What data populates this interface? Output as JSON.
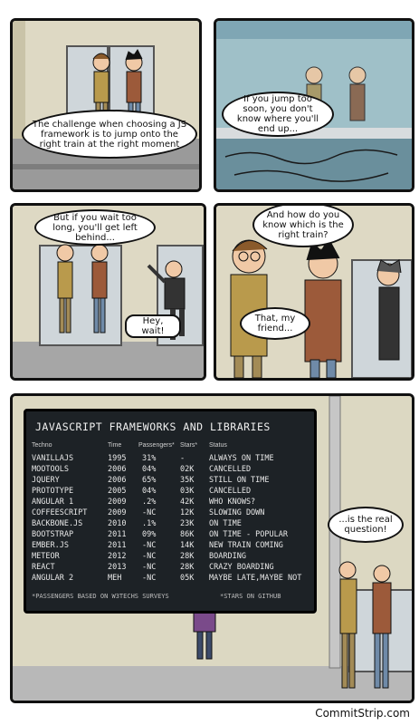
{
  "panel1": {
    "caption": "The challenge when choosing a JS framework is to jump onto the right train at the right moment"
  },
  "panel2": {
    "caption": "If you jump too soon, you don't know where you'll end up..."
  },
  "panel3": {
    "caption1": "But if you wait too long, you'll get left behind...",
    "caption2": "Hey, wait!"
  },
  "panel4": {
    "caption1": "And how do you know which is the right train?",
    "caption2": "That, my friend..."
  },
  "panel5": {
    "board_title": "JAVASCRIPT FRAMEWORKS AND LIBRARIES",
    "headers": {
      "techno": "Techno",
      "time": "Time",
      "passengers": "Passengers*",
      "stars": "Stars*",
      "status": "Status"
    },
    "rows": [
      {
        "techno": "VANILLAJS",
        "time": "1995",
        "passengers": "31%",
        "stars": "-",
        "status": "ALWAYS ON TIME"
      },
      {
        "techno": "MOOTOOLS",
        "time": "2006",
        "passengers": "04%",
        "stars": "02K",
        "status": "CANCELLED"
      },
      {
        "techno": "JQUERY",
        "time": "2006",
        "passengers": "65%",
        "stars": "35K",
        "status": "STILL ON TIME"
      },
      {
        "techno": "PROTOTYPE",
        "time": "2005",
        "passengers": "04%",
        "stars": "03K",
        "status": "CANCELLED"
      },
      {
        "techno": "ANGULAR 1",
        "time": "2009",
        "passengers": ".2%",
        "stars": "42K",
        "status": "WHO KNOWS?"
      },
      {
        "techno": "COFFEESCRIPT",
        "time": "2009",
        "passengers": "-NC",
        "stars": "12K",
        "status": "SLOWING DOWN"
      },
      {
        "techno": "BACKBONE.JS",
        "time": "2010",
        "passengers": ".1%",
        "stars": "23K",
        "status": "ON TIME"
      },
      {
        "techno": "BOOTSTRAP",
        "time": "2011",
        "passengers": "09%",
        "stars": "86K",
        "status": "ON TIME - POPULAR"
      },
      {
        "techno": "EMBER.JS",
        "time": "2011",
        "passengers": "-NC",
        "stars": "14K",
        "status": "NEW TRAIN COMING"
      },
      {
        "techno": "METEOR",
        "time": "2012",
        "passengers": "-NC",
        "stars": "28K",
        "status": "BOARDING"
      },
      {
        "techno": "REACT",
        "time": "2013",
        "passengers": "-NC",
        "stars": "28K",
        "status": "CRAZY BOARDING"
      },
      {
        "techno": "ANGULAR 2",
        "time": "MEH",
        "passengers": "-NC",
        "stars": "05K",
        "status": "MAYBE LATE,MAYBE NOT"
      }
    ],
    "footnote_left": "*PASSENGERS BASED ON W3TECHS SURVEYS",
    "footnote_right": "*STARS ON GITHUB",
    "caption": "...is the real question!"
  },
  "credit": "CommitStrip.com"
}
